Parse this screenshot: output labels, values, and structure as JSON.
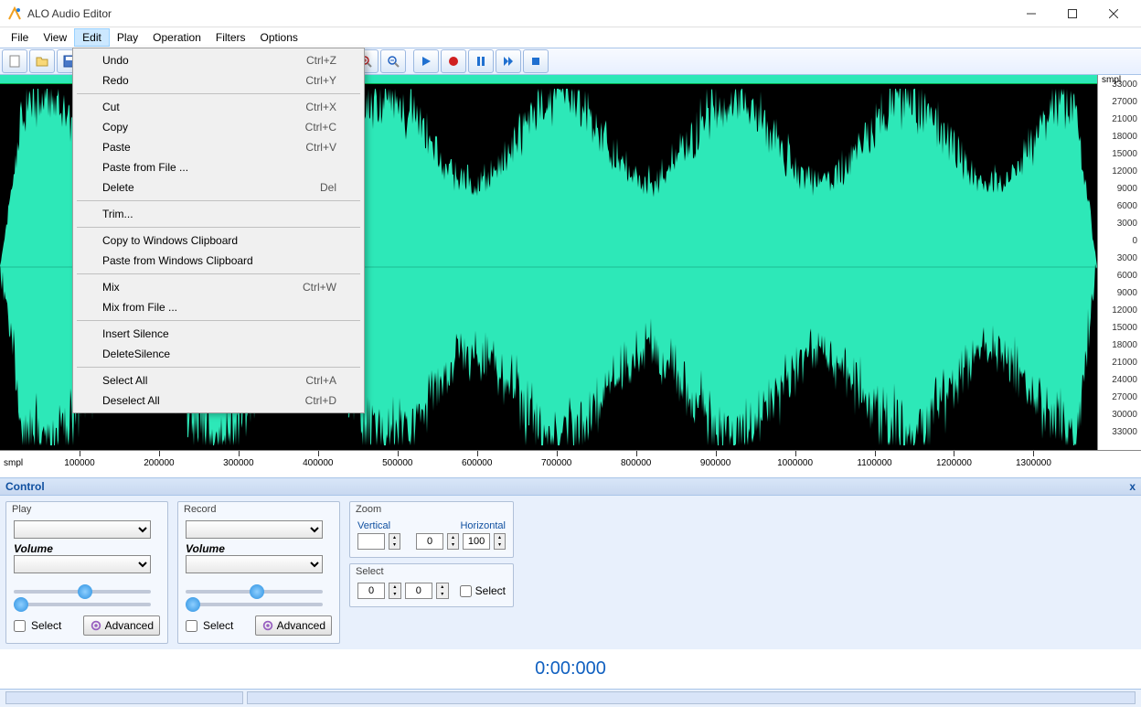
{
  "window": {
    "title": "ALO Audio Editor"
  },
  "menubar": [
    "File",
    "View",
    "Edit",
    "Play",
    "Operation",
    "Filters",
    "Options"
  ],
  "active_menu_index": 2,
  "edit_menu": [
    {
      "type": "item",
      "label": "Undo",
      "shortcut": "Ctrl+Z"
    },
    {
      "type": "item",
      "label": "Redo",
      "shortcut": "Ctrl+Y"
    },
    {
      "type": "sep"
    },
    {
      "type": "item",
      "label": "Cut",
      "shortcut": "Ctrl+X"
    },
    {
      "type": "item",
      "label": "Copy",
      "shortcut": "Ctrl+C"
    },
    {
      "type": "item",
      "label": "Paste",
      "shortcut": "Ctrl+V"
    },
    {
      "type": "item",
      "label": "Paste from File ...",
      "shortcut": ""
    },
    {
      "type": "item",
      "label": "Delete",
      "shortcut": "Del"
    },
    {
      "type": "sep"
    },
    {
      "type": "item",
      "label": "Trim...",
      "shortcut": ""
    },
    {
      "type": "sep"
    },
    {
      "type": "item",
      "label": "Copy to Windows Clipboard",
      "shortcut": ""
    },
    {
      "type": "item",
      "label": "Paste from Windows Clipboard",
      "shortcut": ""
    },
    {
      "type": "sep"
    },
    {
      "type": "item",
      "label": "Mix",
      "shortcut": "Ctrl+W"
    },
    {
      "type": "item",
      "label": "Mix from File ...",
      "shortcut": ""
    },
    {
      "type": "sep"
    },
    {
      "type": "item",
      "label": "Insert Silence",
      "shortcut": ""
    },
    {
      "type": "item",
      "label": "DeleteSilence",
      "shortcut": ""
    },
    {
      "type": "sep"
    },
    {
      "type": "item",
      "label": "Select All",
      "shortcut": "Ctrl+A"
    },
    {
      "type": "item",
      "label": "Deselect All",
      "shortcut": "Ctrl+D"
    }
  ],
  "amplitude_scale": {
    "unit": "smpl",
    "values": [
      33000,
      27000,
      21000,
      18000,
      15000,
      12000,
      9000,
      6000,
      3000,
      0,
      3000,
      6000,
      9000,
      12000,
      15000,
      18000,
      21000,
      24000,
      27000,
      30000,
      33000
    ]
  },
  "time_ruler": {
    "unit": "smpl",
    "ticks": [
      100000,
      200000,
      300000,
      400000,
      500000,
      600000,
      700000,
      800000,
      900000,
      1000000,
      1100000,
      1200000,
      1300000
    ]
  },
  "control": {
    "title": "Control",
    "close": "x",
    "play": {
      "title": "Play",
      "volume_label": "Volume",
      "select_label": "Select",
      "advanced_label": "Advanced"
    },
    "record": {
      "title": "Record",
      "volume_label": "Volume",
      "select_label": "Select",
      "advanced_label": "Advanced"
    },
    "zoom": {
      "title": "Zoom",
      "vertical_label": "Vertical",
      "horizontal_label": "Horizontal",
      "vertical_value": "",
      "h_value1": "0",
      "h_value2": "100"
    },
    "select": {
      "title": "Select",
      "from": "0",
      "to": "0",
      "label": "Select"
    }
  },
  "time_display": "0:00:000",
  "colors": {
    "wave": "#2de8b8",
    "accent": "#1060c0"
  }
}
